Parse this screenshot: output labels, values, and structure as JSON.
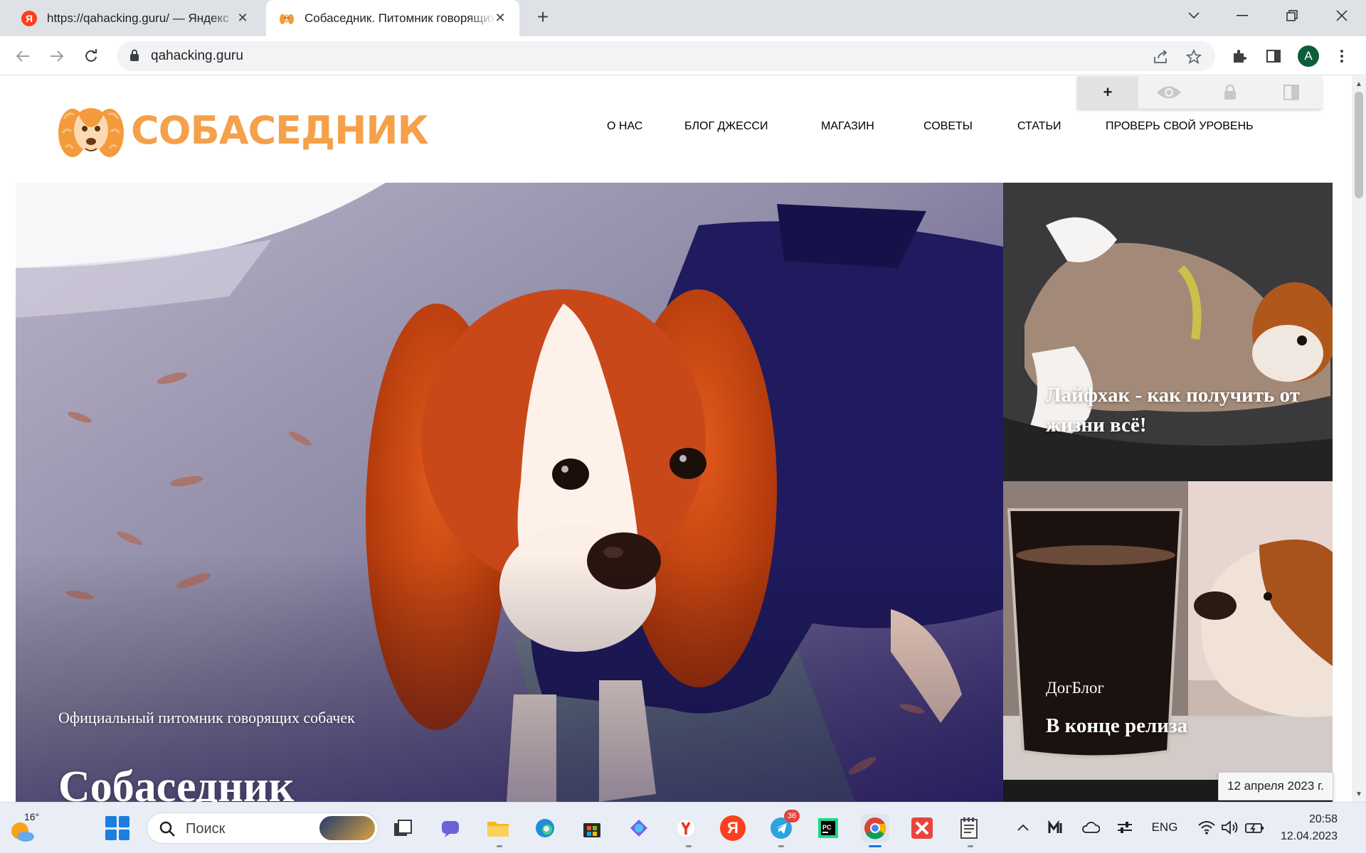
{
  "browser": {
    "tabs": [
      {
        "title": "https://qahacking.guru/ — Яндекс",
        "favicon": "yandex-icon",
        "active": false
      },
      {
        "title": "Собаседник. Питомник говорящих собачек",
        "favicon": "dog-icon",
        "active": true
      }
    ],
    "address": "qahacking.guru",
    "profile_initial": "A"
  },
  "site": {
    "brand": "СОБАСЕДНИК",
    "nav": [
      "О НАС",
      "БЛОГ ДЖЕССИ",
      "МАГАЗИН",
      "СОВЕТЫ",
      "СТАТЬИ",
      "ПРОВЕРЬ СВОЙ УРОВЕНЬ"
    ],
    "a11y_widget": {
      "plus": "+",
      "icons": [
        "eye-icon",
        "lock-icon",
        "contrast-icon"
      ]
    },
    "hero": {
      "subtitle": "Официальный питомник говорящих собачек",
      "title": "Собаседник"
    },
    "side_cards": [
      {
        "category": "",
        "title": "Лайфхак - как получить от жизни всё!"
      },
      {
        "category": "ДогБлог",
        "title": "В конце релиза"
      }
    ],
    "tooltip": "12 апреля 2023 г."
  },
  "taskbar": {
    "weather_temp": "16°",
    "search_placeholder": "Поиск",
    "telegram_badge": "36",
    "language": "ENG",
    "time": "20:58",
    "date": "12.04.2023"
  },
  "colors": {
    "brand_orange": "#f5a04a",
    "nav_text": "#222222",
    "taskbar_bg": "#e9eef6",
    "chrome_tabstrip": "#dee1e6"
  }
}
